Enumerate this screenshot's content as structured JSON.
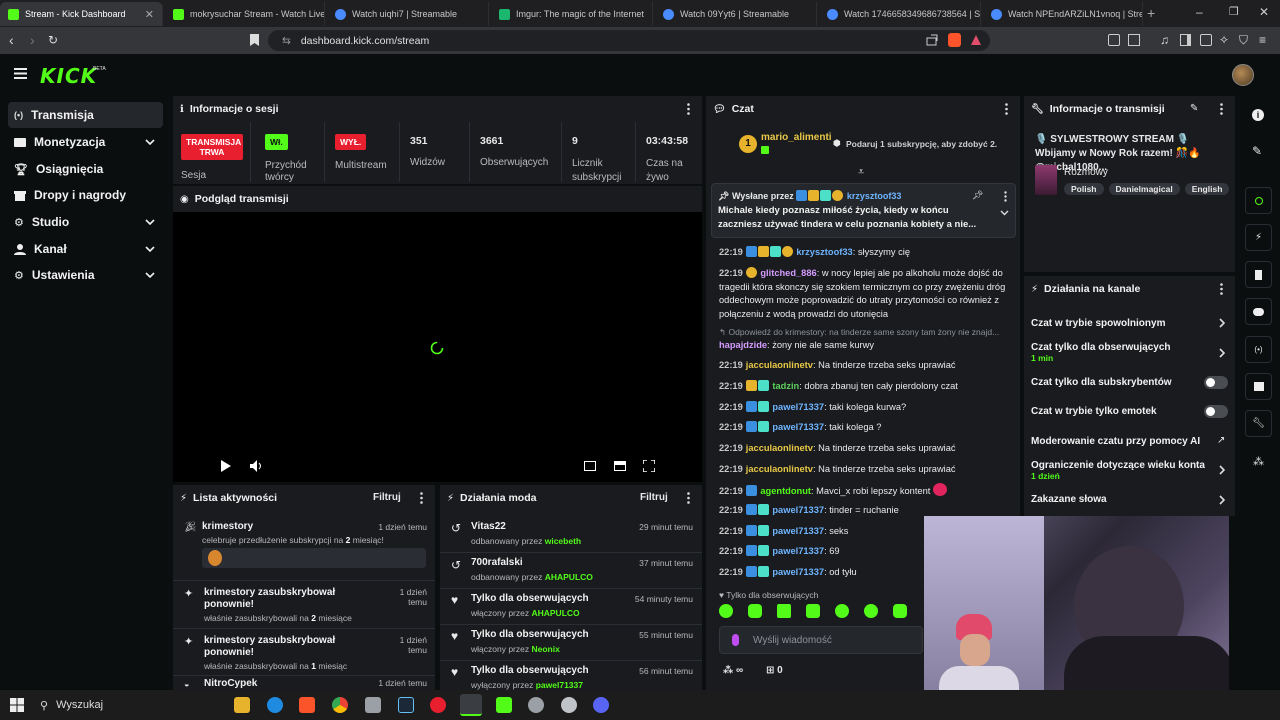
{
  "browser": {
    "tabs": [
      {
        "label": "Stream - Kick Dashboard",
        "color": "#53fc18"
      },
      {
        "label": "mokrysuchar Stream - Watch Live on",
        "color": "#53fc18"
      },
      {
        "label": "Watch uiqhi7 | Streamable",
        "color": "#4a8cff"
      },
      {
        "label": "Imgur: The magic of the Internet",
        "color": "#1bb76e"
      },
      {
        "label": "Watch 09Yyt6 | Streamable",
        "color": "#4a8cff"
      },
      {
        "label": "Watch 1746658349686738564 | Strea",
        "color": "#4a8cff"
      },
      {
        "label": "Watch NPEndARZiLN1vnoq | Stream",
        "color": "#4a8cff"
      }
    ],
    "url": "dashboard.kick.com/stream"
  },
  "brand": {
    "logo": "KICK",
    "beta": "BETA",
    "accent": "#53fc18"
  },
  "sidebar": {
    "items": [
      {
        "label": "Transmisja",
        "icon": "broadcast-icon"
      },
      {
        "label": "Monetyzacja",
        "icon": "wallet-icon"
      },
      {
        "label": "Osiągnięcia",
        "icon": "trophy-icon"
      },
      {
        "label": "Dropy i nagrody",
        "icon": "gift-icon"
      },
      {
        "label": "Studio",
        "icon": "gear-icon"
      },
      {
        "label": "Kanał",
        "icon": "user-icon"
      },
      {
        "label": "Ustawienia",
        "icon": "settings-icon"
      }
    ]
  },
  "session": {
    "title": "Informacje o sesji",
    "live_badge": "TRANSMISJA TRWA",
    "live_label": "Sesja",
    "creator_badge": "Wł.",
    "creator_label": "Przychód twórcy",
    "multistream_badge": "WYŁ.",
    "multistream_label": "Multistream",
    "viewers": "351",
    "viewers_label": "Widzów",
    "followers": "3661",
    "followers_label": "Obserwujących",
    "subs": "9",
    "subs_label": "Licznik subskrypcji",
    "uptime": "03:43:58",
    "uptime_label": "Czas na żywo"
  },
  "preview": {
    "title": "Podgląd transmisji"
  },
  "activity": {
    "title": "Lista aktywności",
    "filter": "Filtruj",
    "items": [
      {
        "title": "krimestory",
        "sub_pre": "celebruje przedłużenie subskrypcji na ",
        "sub_num": "2",
        "sub_post": " miesiąc!",
        "time": "1 dzień temu"
      },
      {
        "title": "krimestory zasubskrybował ponownie!",
        "sub_pre": "właśnie zasubskrybowali na ",
        "sub_num": "2",
        "sub_post": " miesiące",
        "time": "1 dzień temu"
      },
      {
        "title": "krimestory zasubskrybował ponownie!",
        "sub_pre": "właśnie zasubskrybowali na ",
        "sub_num": "1",
        "sub_post": " miesiąc",
        "time": "1 dzień temu"
      },
      {
        "title": "NitroCypek",
        "time": "1 dzień temu"
      }
    ]
  },
  "modactions": {
    "title": "Działania moda",
    "filter": "Filtruj",
    "items": [
      {
        "title": "Vitas22",
        "sub": "odbanowany przez ",
        "by": "wicebeth",
        "time": "29 minut temu"
      },
      {
        "title": "700rafalski",
        "sub": "odbanowany przez ",
        "by": "AHAPULCO",
        "time": "37 minut temu"
      },
      {
        "title": "Tylko dla obserwujących",
        "sub": "włączony przez ",
        "by": "AHAPULCO",
        "time": "54 minuty temu"
      },
      {
        "title": "Tylko dla obserwujących",
        "sub": "włączony przez ",
        "by": "Neonix",
        "time": "55 minut temu"
      },
      {
        "title": "Tylko dla obserwujących",
        "sub": "wyłączony przez ",
        "by": "pawel71337",
        "time": "56 minut temu"
      }
    ]
  },
  "chat": {
    "title": "Czat",
    "gift_user": "mario_alimenti",
    "gift_count": "1",
    "gift_text": "Podaruj 1 subskrypcję, aby zdobyć 2.",
    "pinned_by": "Wysłane przez",
    "pinned_user": "krzysztoof33",
    "pinned_text": "Michale kiedy poznasz miłość życia, kiedy w końcu zaczniesz używać tindera w celu poznania kobiety a nie...",
    "reply_to": "Odpowiedź do krimestory: na tinderze same szony tam żony nie znajd...",
    "messages": [
      {
        "time": "22:19",
        "user": "krzysztoof33",
        "text": ": słyszymy cię"
      },
      {
        "time": "22:19",
        "user": "glitched_886",
        "text": ": w nocy lepiej ale po alkoholu może dojść do tragedii która skonczy się szokiem termicznym co przy zwężeniu dróg oddechowym może poprowadzić do utraty przytomości co również z połączeniu z wodą prowadzi do utonięcia"
      },
      {
        "user": "hapajdzide",
        "text": ": żony nie ale same kurwy"
      },
      {
        "time": "22:19",
        "user": "jacculaonlinetv",
        "text": ": Na tinderze trzeba seks uprawiać"
      },
      {
        "time": "22:19",
        "user": "tadzin",
        "text": ": dobra zbanuj ten cały pierdolony czat"
      },
      {
        "time": "22:19",
        "user": "pawel71337",
        "text": ": taki kolega kurwa?"
      },
      {
        "time": "22:19",
        "user": "pawel71337",
        "text": ": taki kolega ?"
      },
      {
        "time": "22:19",
        "user": "jacculaonlinetv",
        "text": ": Na tinderze trzeba seks uprawiać"
      },
      {
        "time": "22:19",
        "user": "jacculaonlinetv",
        "text": ": Na tinderze trzeba seks uprawiać"
      },
      {
        "time": "22:19",
        "user": "agentdonut",
        "text": ": Mavci_x robi lepszy kontent"
      },
      {
        "time": "22:19",
        "user": "pawel71337",
        "text": ": tinder = ruchanie"
      },
      {
        "time": "22:19",
        "user": "pawel71337",
        "text": ": seks"
      },
      {
        "time": "22:19",
        "user": "pawel71337",
        "text": ": 69"
      },
      {
        "time": "22:19",
        "user": "pawel71337",
        "text": ": od tyłu"
      }
    ],
    "followers_only": "Tylko dla obserwujących",
    "input_placeholder": "Wyślij wiadomość",
    "points": "∞",
    "gifts": "0"
  },
  "streaminfo": {
    "title": "Informacje o transmisji",
    "stream_title": "🎙️ SYLWESTROWY STREAM 🎙️ Wbijamy w Nowy Rok razem! 🎊🔥 @michal1080...",
    "category": "Rozmowy",
    "tags": [
      "Polish",
      "Danielmagical",
      "English",
      "I"
    ]
  },
  "channel_actions": {
    "title": "Działania na kanale",
    "items": [
      {
        "label": "Czat w trybie spowolnionym",
        "kind": "chevron"
      },
      {
        "label": "Czat tylko dla obserwujących",
        "sub": "1 min",
        "kind": "chevron"
      },
      {
        "label": "Czat tylko dla subskrybentów",
        "kind": "toggle",
        "value": false
      },
      {
        "label": "Czat w trybie tylko emotek",
        "kind": "toggle",
        "value": false
      },
      {
        "label": "Moderowanie czatu przy pomocy AI",
        "kind": "external"
      },
      {
        "label": "Ograniczenie dotyczące wieku konta",
        "sub": "1 dzień",
        "kind": "chevron"
      },
      {
        "label": "Zakazane słowa",
        "kind": "chevron"
      }
    ]
  },
  "taskbar": {
    "search": "Wyszukaj"
  }
}
